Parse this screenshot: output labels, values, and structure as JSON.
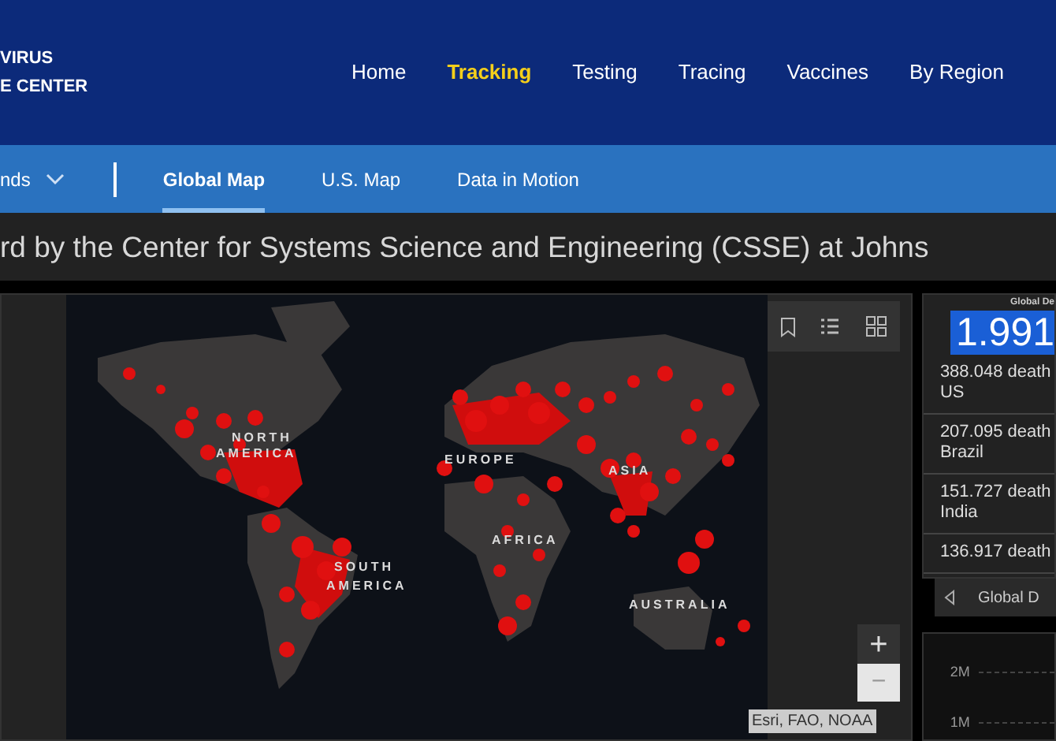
{
  "logo": {
    "lines": [
      "VIRUS",
      "E CENTER"
    ]
  },
  "nav": [
    {
      "label": "Home",
      "selected": false
    },
    {
      "label": "Tracking",
      "selected": true
    },
    {
      "label": "Testing",
      "selected": false
    },
    {
      "label": "Tracing",
      "selected": false
    },
    {
      "label": "Vaccines",
      "selected": false
    },
    {
      "label": "By Region",
      "selected": false
    }
  ],
  "subnav": {
    "dropdown": "nds",
    "tabs": [
      {
        "label": "Global Map",
        "selected": true
      },
      {
        "label": "U.S. Map",
        "selected": false
      },
      {
        "label": "Data in Motion",
        "selected": false
      }
    ]
  },
  "banner": "rd by the Center for Systems Science and Engineering (CSSE) at Johns",
  "map": {
    "labels": [
      "NORTH",
      "AMERICA",
      "EUROPE",
      "ASIA",
      "AFRICA",
      "SOUTH",
      "AMERICA",
      "AUSTRALIA"
    ],
    "zoom_in": "+",
    "zoom_out": "−",
    "attribution": "Esri, FAO, NOAA"
  },
  "deaths_panel": {
    "title": "Global De",
    "total": "1.991",
    "rows": [
      {
        "value": "388.048 death",
        "country": "US"
      },
      {
        "value": "207.095 death",
        "country": "Brazil"
      },
      {
        "value": "151.727 death",
        "country": "India"
      },
      {
        "value": "136.917 death"
      }
    ],
    "pager_label": "Global D"
  },
  "chart": {
    "y_tick_labels": [
      "2M",
      "1M"
    ]
  }
}
